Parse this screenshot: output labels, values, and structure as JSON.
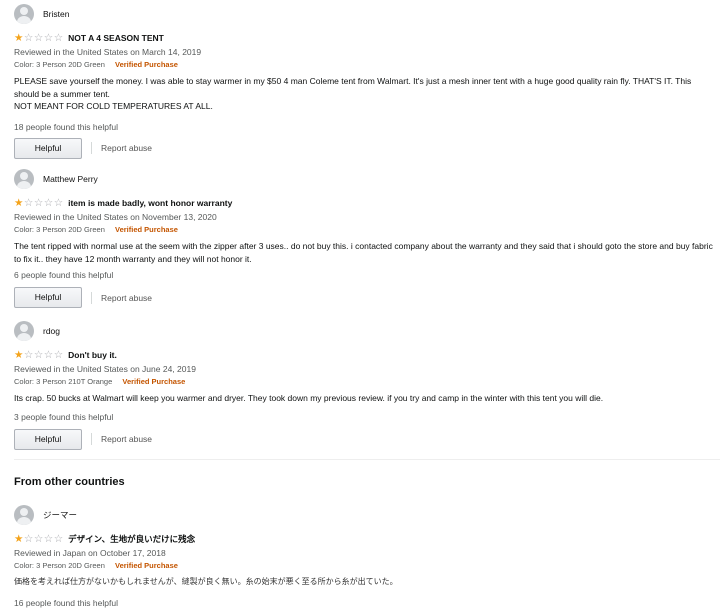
{
  "reviews": [
    {
      "name": "Bristen",
      "title": "NOT A 4 SEASON TENT",
      "date": "Reviewed in the United States on March 14, 2019",
      "color": "Color: 3 Person 20D Green",
      "verified": "Verified Purchase",
      "body": [
        "PLEASE save yourself the money. I was able to stay warmer in my $50 4 man Coleme tent from Walmart. It's just a mesh inner tent with a huge good quality rain fly. THAT'S IT. This should be a summer tent.",
        "NOT MEANT FOR COLD TEMPERATURES AT ALL."
      ],
      "helpful_count": "18 people found this helpful",
      "helpful_label": "Helpful",
      "report_label": "Report abuse",
      "rating": 1
    },
    {
      "name": "Matthew Perry",
      "title": "item is made badly, wont honor warranty",
      "date": "Reviewed in the United States on November 13, 2020",
      "color": "Color: 3 Person 20D Green",
      "verified": "Verified Purchase",
      "body": [
        "The tent ripped with normal use at the seem with the zipper after 3 uses.. do not buy this. i contacted company about the warranty and they said that i should goto the store and buy fabric to fix it.. they have 12 month warranty and they will not honor it."
      ],
      "helpful_count": "6 people found this helpful",
      "helpful_label": "Helpful",
      "report_label": "Report abuse",
      "rating": 1
    },
    {
      "name": "rdog",
      "title": "Don't buy it.",
      "date": "Reviewed in the United States on June 24, 2019",
      "color": "Color: 3 Person 210T Orange",
      "verified": "Verified Purchase",
      "body": [
        "Its crap. 50 bucks at Walmart will keep you warmer and dryer. They took down my previous review. if you try and camp in the winter with this tent you will die."
      ],
      "helpful_count": "3 people found this helpful",
      "helpful_label": "Helpful",
      "report_label": "Report abuse",
      "rating": 1
    }
  ],
  "other_countries": {
    "heading": "From other countries",
    "review": {
      "name": "ジーマー",
      "title": "デザイン、生地が良いだけに残念",
      "date": "Reviewed in Japan on October 17, 2018",
      "color": "Color: 3 Person 20D Green",
      "verified": "Verified Purchase",
      "body": "価格を考えれば仕方がないかもしれませんが、縫製が良く無い。糸の始末が悪く至る所から糸が出ていた。",
      "helpful_count": "16 people found this helpful",
      "rating": 1
    }
  },
  "colors": {
    "star_filled": "#f4a31b",
    "star_empty": "#a7a8ad",
    "verified": "#c45500",
    "secondary_text": "#565959"
  },
  "icons": {
    "avatar": "default-profile-avatar-icon",
    "star": "star-icon"
  }
}
